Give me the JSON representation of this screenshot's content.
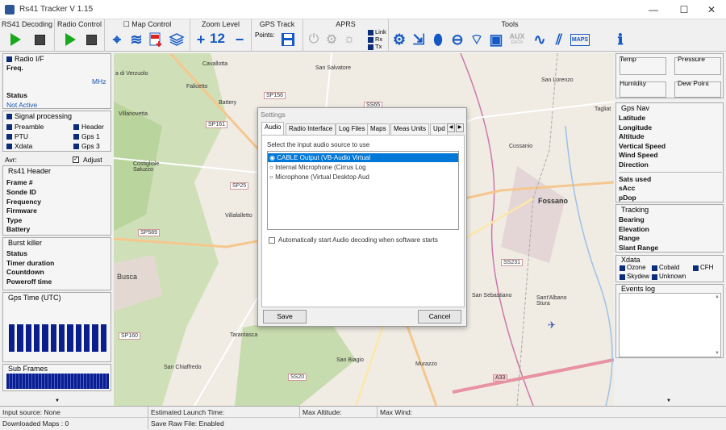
{
  "window": {
    "title": "Rs41 Tracker V 1.15",
    "minimize": "—",
    "maximize": "☐",
    "close": "✕"
  },
  "toolbar": {
    "rs41_decoding": "RS41 Decoding",
    "radio_control": "Radio Control",
    "map_control": "Map Control",
    "map_control_checkbox": "☐",
    "zoom_level_title": "Zoom Level",
    "zoom_value": "12",
    "gps_track_title": "GPS Track",
    "gps_points_label": "Points:",
    "aprs_title": "APRS",
    "aprs_link": "Link",
    "aprs_rx": "Rx",
    "aprs_tx": "Tx",
    "tools_title": "Tools",
    "aux_label": "AUX",
    "aux_sub": "DATA",
    "maps_label": "MAPS"
  },
  "radio": {
    "title": "Radio I/F",
    "freq_label": "Freq.",
    "unit": "MHz",
    "status_label": "Status",
    "status_value": "Not Active"
  },
  "signal": {
    "title": "Signal processing",
    "items": [
      "Preamble",
      "Header",
      "PTU",
      "Gps 1",
      "Xdata",
      "Gps 3"
    ],
    "avr_label": "Avr:",
    "adjust_label": "Adjust",
    "adjust_check": "✓"
  },
  "header_panel": {
    "title": "Rs41 Header",
    "fields": [
      "Frame #",
      "Sonde ID",
      "Frequency",
      "Firmware",
      "Type",
      "Battery"
    ]
  },
  "burst": {
    "title": "Burst killer",
    "fields": [
      "Status",
      "Timer duration",
      "Countdown",
      "Poweroff time"
    ]
  },
  "gps_time": {
    "title": "Gps Time (UTC)"
  },
  "sub_frames": {
    "title": "Sub Frames"
  },
  "right": {
    "temp": "Temp",
    "pressure": "Pressure",
    "humidity": "Humidity",
    "dew_point": "Dew Point",
    "gps_nav_title": "Gps Nav",
    "gps_nav": [
      "Latitude",
      "Longitude",
      "Altitude",
      "Vertical Speed",
      "Wind Speed",
      "Direction"
    ],
    "sats": [
      "Sats used",
      "sAcc",
      "pDop"
    ],
    "tracking_title": "Tracking",
    "tracking": [
      "Bearing",
      "Elevation",
      "Range",
      "Slant Range"
    ],
    "xdata_title": "Xdata",
    "xdata": [
      "Ozone",
      "Cobald",
      "CFH",
      "Skydew",
      "Unknown"
    ],
    "events_title": "Events log"
  },
  "map": {
    "places": [
      "Cavallotta",
      "San Salvatore",
      "Falicetto",
      "Battery",
      "Villanovetta",
      "a di Verzuolo",
      "San Lorenzo",
      "Tagliat",
      "Costigliole Saluzzo",
      "Villafalletto",
      "Cussanio",
      "Fossano",
      "Busca",
      "San Sebastiano",
      "Sant'Albano Stura",
      "Tarantasca",
      "San Chiaffredo",
      "San Biagio",
      "Murazzo"
    ],
    "roads": [
      "SP156",
      "SP161",
      "SS65",
      "SP25",
      "SP589",
      "SS231",
      "SP160",
      "SS20",
      "A33"
    ]
  },
  "dialog": {
    "title": "Settings",
    "tabs": [
      "Audio",
      "Radio Interface",
      "Log Files",
      "Maps",
      "Meas Units",
      "Upd"
    ],
    "prompt": "Select the input audio source to use",
    "sources": [
      "CABLE Output (VB-Audio Virtual",
      "Internal Microphone (Cirrus Log",
      "Microphone (Virtual Desktop Aud"
    ],
    "autostart": "Automatically start Audio decoding when software starts",
    "save": "Save",
    "cancel": "Cancel"
  },
  "status": {
    "input_source": "Input source: None",
    "launch_time": "Estimated Launch Time:",
    "max_altitude": "Max Altitude:",
    "max_wind": "Max Wind:",
    "downloaded_maps": "Downloaded Maps : 0",
    "save_raw": "Save Raw File: Enabled"
  },
  "colors": {
    "accent": "#1459c4",
    "play": "#19a81e",
    "select": "#0078d7",
    "bars": "#0b1f8c"
  }
}
